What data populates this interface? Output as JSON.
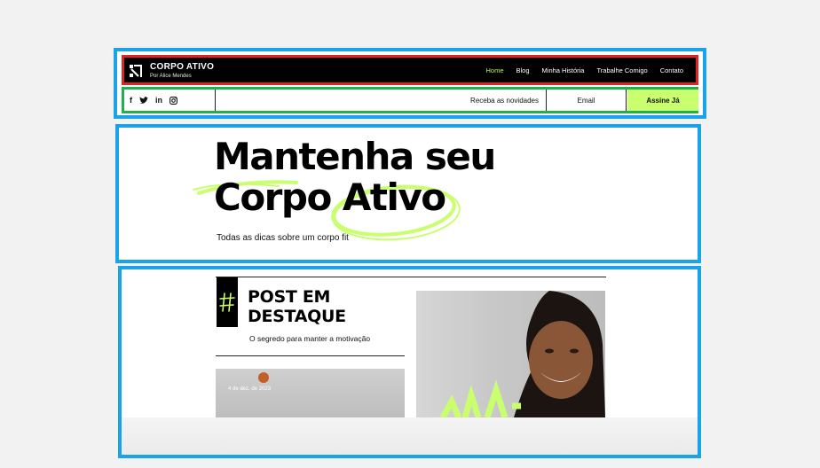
{
  "header": {
    "brand_title": "CORPO ATIVO",
    "brand_subtitle": "Por Alice Mendes",
    "nav": [
      "Home",
      "Blog",
      "Minha História",
      "Trabalhe Comigo",
      "Contato"
    ],
    "active_nav": "Home"
  },
  "newsletter": {
    "label": "Receba as novidades",
    "email_placeholder": "Email",
    "subscribe_label": "Assine Já"
  },
  "socials": [
    "facebook-icon",
    "twitter-icon",
    "linkedin-icon",
    "instagram-icon"
  ],
  "hero": {
    "title_line1": "Mantenha seu",
    "title_line2": "Corpo Ativo",
    "subtitle": "Todas as dicas sobre um corpo fit"
  },
  "featured": {
    "heading_line1": "POST EM",
    "heading_line2": "DESTAQUE",
    "subtitle": "O segredo para manter a motivação",
    "post_date": "4 de dez. de 2023"
  },
  "colors": {
    "accent": "#c9ff6e",
    "selection": "#1aa3e8",
    "header_border": "#e02424",
    "subbar_border": "#1db34a"
  }
}
